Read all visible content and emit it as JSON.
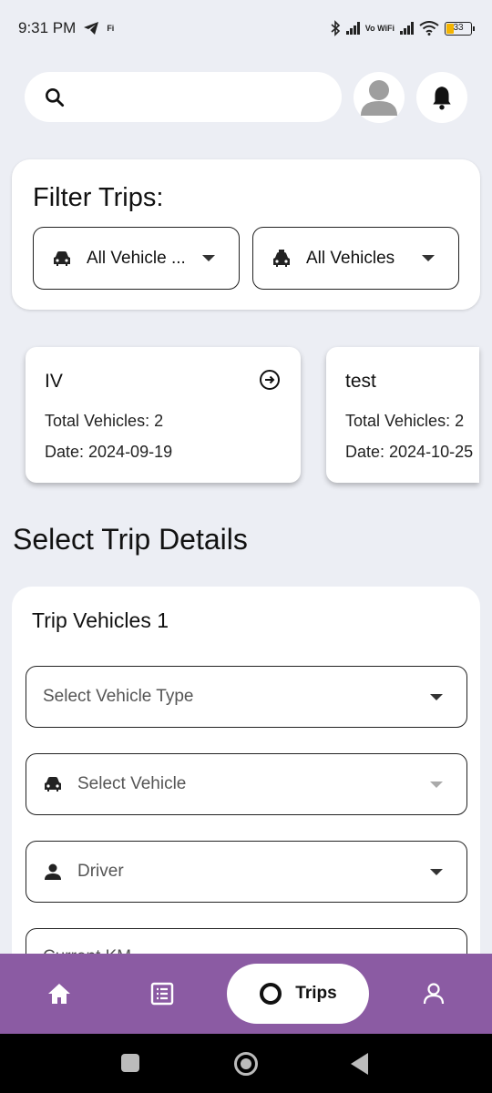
{
  "status_bar": {
    "time": "9:31 PM",
    "network_label": "Vo WiFi",
    "battery": "33"
  },
  "search": {
    "placeholder": ""
  },
  "filter": {
    "title": "Filter Trips:",
    "vehicle_type_label": "All Vehicle ...",
    "vehicles_label": "All Vehicles"
  },
  "trips": [
    {
      "name": "IV",
      "total_vehicles": "Total Vehicles: 2",
      "date": "Date: 2024-09-19"
    },
    {
      "name": "test",
      "total_vehicles": "Total Vehicles: 2",
      "date": "Date: 2024-10-25"
    }
  ],
  "details": {
    "section_title": "Select Trip Details",
    "subtitle": "Trip Vehicles 1",
    "vehicle_type_placeholder": "Select Vehicle Type",
    "vehicle_placeholder": "Select Vehicle",
    "driver_placeholder": "Driver",
    "start_km_placeholder": "Current KM"
  },
  "bottom_nav": {
    "active_label": "Trips",
    "items": [
      "home-icon",
      "list-icon",
      "trips-icon",
      "person-icon"
    ]
  },
  "colors": {
    "background": "#eceef4",
    "nav_bar": "#8b5ba3",
    "card": "#ffffff"
  }
}
